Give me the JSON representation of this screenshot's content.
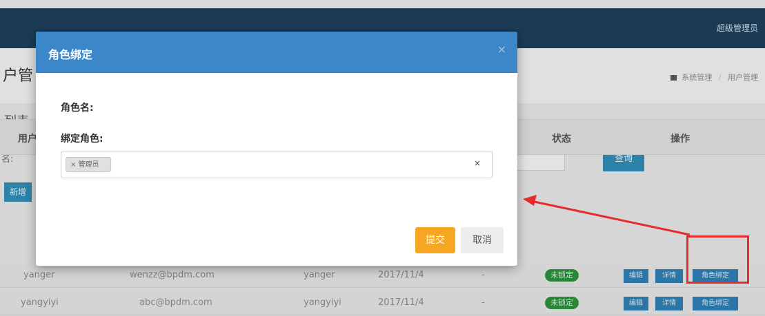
{
  "topnav": {
    "user_label": "超级管理员"
  },
  "page": {
    "title_fragment": "户管",
    "breadcrumb": [
      "系统管理",
      "用户管理"
    ]
  },
  "panel": {
    "list_title": "列表",
    "filter_label": "名:",
    "query_button": "查询",
    "add_button": "新增"
  },
  "table": {
    "headers": [
      "用户",
      "状态",
      "操作"
    ],
    "rows": [
      {
        "username": "yanger",
        "email": "wenzz@bpdm.com",
        "name": "yanger",
        "date": "2017/11/4",
        "dash": "-",
        "status": "未锁定",
        "ops": [
          "编辑",
          "详情",
          "角色绑定"
        ]
      },
      {
        "username": "yangyiyi",
        "email": "abc@bpdm.com",
        "name": "yangyiyi",
        "date": "2017/11/4",
        "dash": "-",
        "status": "未锁定",
        "ops": [
          "编辑",
          "详情",
          "角色绑定"
        ]
      }
    ]
  },
  "modal": {
    "title": "角色绑定",
    "close": "×",
    "role_name_label": "角色名:",
    "bind_role_label": "绑定角色:",
    "selected_tag": "× 管理员",
    "clear": "×",
    "submit": "提交",
    "cancel": "取消"
  },
  "colors": {
    "header": "#3b87c9",
    "submit": "#f5a623",
    "highlight": "#e52b2b"
  }
}
